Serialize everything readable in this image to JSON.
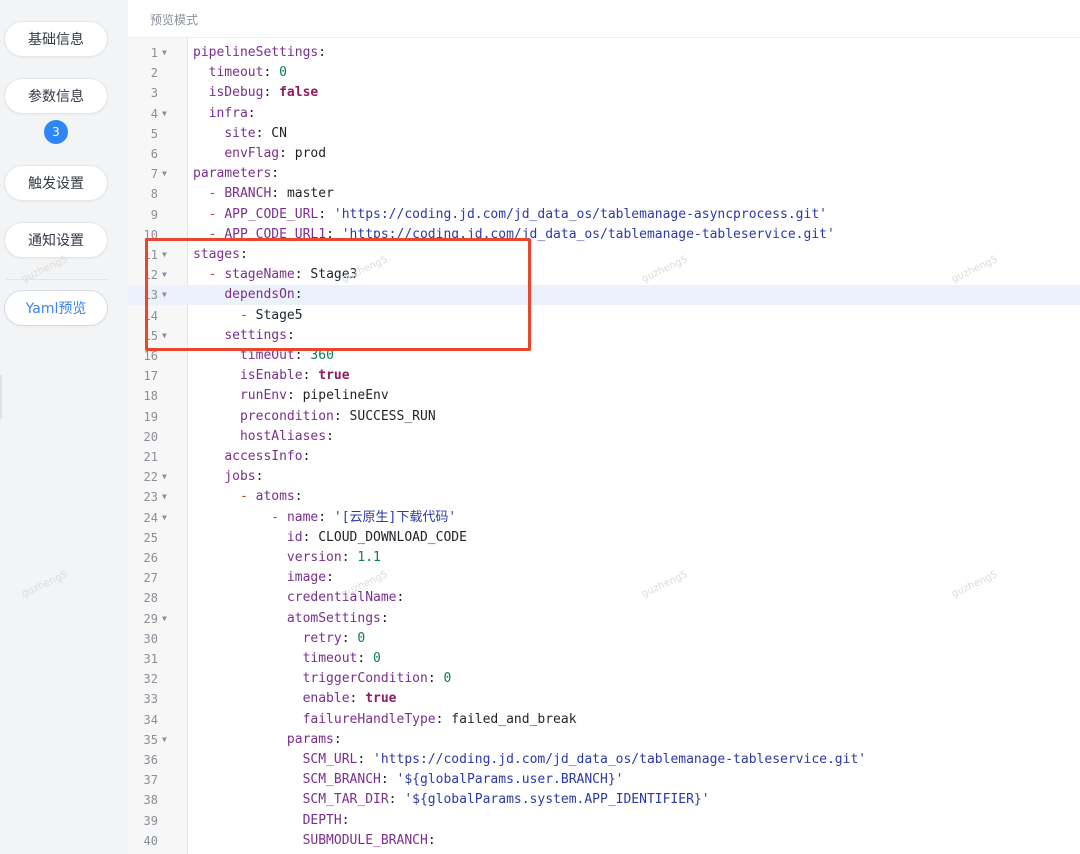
{
  "sidebar": {
    "items": [
      {
        "label": "基础信息"
      },
      {
        "label": "参数信息",
        "badge": "3"
      },
      {
        "label": "触发设置"
      },
      {
        "label": "通知设置"
      },
      {
        "label": "Yaml预览",
        "active": true
      }
    ]
  },
  "panel": {
    "title": "预览模式"
  },
  "editor": {
    "highlighted_line": 13,
    "lines": [
      {
        "n": "1",
        "fold": true,
        "indent": 0,
        "key": "pipelineSettings",
        "colon": true
      },
      {
        "n": "2",
        "indent": 2,
        "key": "timeout",
        "colon": true,
        "value": "0",
        "vt": "n"
      },
      {
        "n": "3",
        "indent": 2,
        "key": "isDebug",
        "colon": true,
        "value": "false",
        "vt": "b"
      },
      {
        "n": "4",
        "fold": true,
        "indent": 2,
        "key": "infra",
        "colon": true
      },
      {
        "n": "5",
        "indent": 4,
        "key": "site",
        "colon": true,
        "value": "CN",
        "vt": "p"
      },
      {
        "n": "6",
        "indent": 4,
        "key": "envFlag",
        "colon": true,
        "value": "prod",
        "vt": "p"
      },
      {
        "n": "7",
        "fold": true,
        "indent": 0,
        "key": "parameters",
        "colon": true
      },
      {
        "n": "8",
        "indent": 2,
        "dash": true,
        "key": "BRANCH",
        "colon": true,
        "value": "master",
        "vt": "p"
      },
      {
        "n": "9",
        "indent": 2,
        "dash": true,
        "key": "APP_CODE_URL",
        "colon": true,
        "value": "'https://coding.jd.com/jd_data_os/tablemanage-asyncprocess.git'",
        "vt": "s"
      },
      {
        "n": "10",
        "indent": 2,
        "dash": true,
        "key": "APP_CODE_URL1",
        "colon": true,
        "value": "'https://coding.jd.com/jd_data_os/tablemanage-tableservice.git'",
        "vt": "s"
      },
      {
        "n": "11",
        "fold": true,
        "indent": 0,
        "key": "stages",
        "colon": true
      },
      {
        "n": "12",
        "fold": true,
        "indent": 2,
        "dash": true,
        "key": "stageName",
        "colon": true,
        "value": "Stage3",
        "vt": "p"
      },
      {
        "n": "13",
        "fold": true,
        "indent": 4,
        "key": "dependsOn",
        "colon": true
      },
      {
        "n": "14",
        "indent": 6,
        "dash": true,
        "value": "Stage5",
        "vt": "p"
      },
      {
        "n": "15",
        "fold": true,
        "indent": 4,
        "key": "settings",
        "colon": true
      },
      {
        "n": "16",
        "indent": 6,
        "key": "timeOut",
        "colon": true,
        "value": "360",
        "vt": "n"
      },
      {
        "n": "17",
        "indent": 6,
        "key": "isEnable",
        "colon": true,
        "value": "true",
        "vt": "b"
      },
      {
        "n": "18",
        "indent": 6,
        "key": "runEnv",
        "colon": true,
        "value": "pipelineEnv",
        "vt": "p"
      },
      {
        "n": "19",
        "indent": 6,
        "key": "precondition",
        "colon": true,
        "value": "SUCCESS_RUN",
        "vt": "p"
      },
      {
        "n": "20",
        "indent": 6,
        "key": "hostAliases",
        "colon": true
      },
      {
        "n": "21",
        "indent": 4,
        "key": "accessInfo",
        "colon": true
      },
      {
        "n": "22",
        "fold": true,
        "indent": 4,
        "key": "jobs",
        "colon": true
      },
      {
        "n": "23",
        "fold": true,
        "indent": 6,
        "dash": true,
        "key": "atoms",
        "colon": true
      },
      {
        "n": "24",
        "fold": true,
        "indent": 10,
        "dash": true,
        "key": "name",
        "colon": true,
        "value": "'[云原生]下载代码'",
        "vt": "s"
      },
      {
        "n": "25",
        "indent": 12,
        "key": "id",
        "colon": true,
        "value": "CLOUD_DOWNLOAD_CODE",
        "vt": "p"
      },
      {
        "n": "26",
        "indent": 12,
        "key": "version",
        "colon": true,
        "value": "1.1",
        "vt": "n"
      },
      {
        "n": "27",
        "indent": 12,
        "key": "image",
        "colon": true
      },
      {
        "n": "28",
        "indent": 12,
        "key": "credentialName",
        "colon": true
      },
      {
        "n": "29",
        "fold": true,
        "indent": 12,
        "key": "atomSettings",
        "colon": true
      },
      {
        "n": "30",
        "indent": 14,
        "key": "retry",
        "colon": true,
        "value": "0",
        "vt": "n"
      },
      {
        "n": "31",
        "indent": 14,
        "key": "timeout",
        "colon": true,
        "value": "0",
        "vt": "n"
      },
      {
        "n": "32",
        "indent": 14,
        "key": "triggerCondition",
        "colon": true,
        "value": "0",
        "vt": "n"
      },
      {
        "n": "33",
        "indent": 14,
        "key": "enable",
        "colon": true,
        "value": "true",
        "vt": "b"
      },
      {
        "n": "34",
        "indent": 14,
        "key": "failureHandleType",
        "colon": true,
        "value": "failed_and_break",
        "vt": "p"
      },
      {
        "n": "35",
        "fold": true,
        "indent": 12,
        "key": "params",
        "colon": true
      },
      {
        "n": "36",
        "indent": 14,
        "key": "SCM_URL",
        "colon": true,
        "value": "'https://coding.jd.com/jd_data_os/tablemanage-tableservice.git'",
        "vt": "s"
      },
      {
        "n": "37",
        "indent": 14,
        "key": "SCM_BRANCH",
        "colon": true,
        "value": "'${globalParams.user.BRANCH}'",
        "vt": "s"
      },
      {
        "n": "38",
        "indent": 14,
        "key": "SCM_TAR_DIR",
        "colon": true,
        "value": "'${globalParams.system.APP_IDENTIFIER}'",
        "vt": "s"
      },
      {
        "n": "39",
        "indent": 14,
        "key": "DEPTH",
        "colon": true
      },
      {
        "n": "40",
        "indent": 14,
        "key": "SUBMODULE_BRANCH",
        "colon": true
      }
    ]
  },
  "watermark": "guzheng5",
  "colors": {
    "key": "#7a2f8f",
    "string": "#2b3aa8",
    "number": "#0b7a56",
    "boolean": "#8f1b64",
    "dash": "#c93b2b",
    "accent": "#2f86f6",
    "callout": "#e8472e"
  }
}
